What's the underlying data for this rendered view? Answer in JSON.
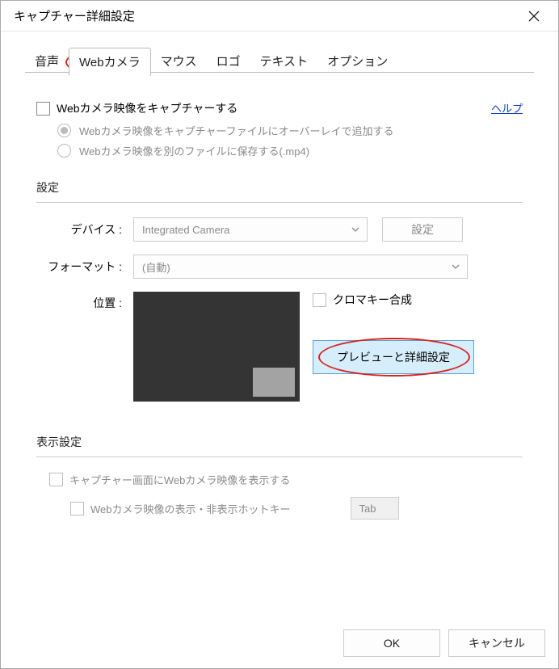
{
  "window": {
    "title": "キャプチャー詳細設定"
  },
  "tabs": {
    "items": [
      "音声",
      "Webカメラ",
      "マウス",
      "ロゴ",
      "テキスト",
      "オプション"
    ],
    "active_index": 1
  },
  "help_link": "ヘルプ",
  "main_checkbox": "Webカメラ映像をキャプチャーする",
  "radio_options": {
    "overlay": "Webカメラ映像をキャプチャーファイルにオーバーレイで追加する",
    "save_mp4": "Webカメラ映像を別のファイルに保存する(.mp4)"
  },
  "settings_group": {
    "legend": "設定",
    "device_label": "デバイス :",
    "device_value": "Integrated Camera",
    "device_settings_btn": "設定",
    "format_label": "フォーマット :",
    "format_value": "(自動)",
    "position_label": "位置 :",
    "chroma_key": "クロマキー合成",
    "preview_btn": "プレビューと詳細設定"
  },
  "display_group": {
    "legend": "表示設定",
    "show_on_capture": "キャプチャー画面にWebカメラ映像を表示する",
    "hotkey_label": "Webカメラ映像の表示・非表示ホットキー",
    "hotkey_value": "Tab"
  },
  "footer": {
    "ok": "OK",
    "cancel": "キャンセル"
  }
}
